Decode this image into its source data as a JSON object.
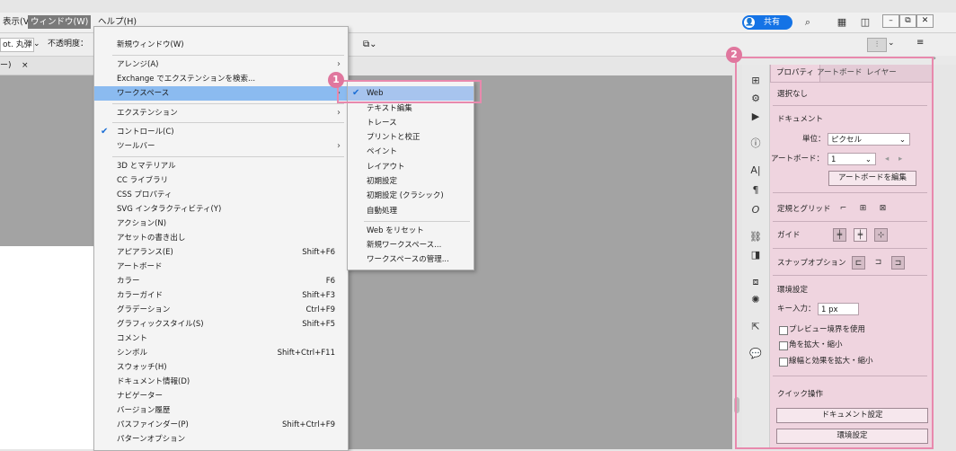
{
  "menubar": {
    "items": [
      {
        "label": "表示(V)"
      },
      {
        "label": "ウィンドウ(W)"
      },
      {
        "label": "ヘルプ(H)"
      }
    ],
    "share_label": "共有",
    "window_min": "–",
    "window_restore": "⧉",
    "window_close": "✕"
  },
  "controlbar": {
    "font": "ot. 丸弾",
    "opacity_label": "不透明度："
  },
  "tabs": {
    "close": "×",
    "partial": "ー)"
  },
  "window_menu": {
    "items": [
      {
        "label": "新規ウィンドウ(W)",
        "shortcut": "",
        "submenu": false,
        "checked": false
      },
      {
        "label": "アレンジ(A)",
        "shortcut": "",
        "submenu": true,
        "checked": false
      },
      {
        "label": "Exchange でエクステンションを検索...",
        "shortcut": "",
        "submenu": false,
        "checked": false
      },
      {
        "label": "ワークスペース",
        "shortcut": "",
        "submenu": true,
        "checked": false,
        "highlighted": true
      },
      {
        "label": "エクステンション",
        "shortcut": "",
        "submenu": true,
        "checked": false
      },
      {
        "label": "コントロール(C)",
        "shortcut": "",
        "submenu": false,
        "checked": true
      },
      {
        "label": "ツールバー",
        "shortcut": "",
        "submenu": true,
        "checked": false
      },
      {
        "label": "3D とマテリアル",
        "shortcut": "",
        "submenu": false,
        "checked": false
      },
      {
        "label": "CC ライブラリ",
        "shortcut": "",
        "submenu": false,
        "checked": false
      },
      {
        "label": "CSS プロパティ",
        "shortcut": "",
        "submenu": false,
        "checked": false
      },
      {
        "label": "SVG インタラクティビティ(Y)",
        "shortcut": "",
        "submenu": false,
        "checked": false
      },
      {
        "label": "アクション(N)",
        "shortcut": "",
        "submenu": false,
        "checked": false
      },
      {
        "label": "アセットの書き出し",
        "shortcut": "",
        "submenu": false,
        "checked": false
      },
      {
        "label": "アピアランス(E)",
        "shortcut": "Shift+F6",
        "submenu": false,
        "checked": false
      },
      {
        "label": "アートボード",
        "shortcut": "",
        "submenu": false,
        "checked": false
      },
      {
        "label": "カラー",
        "shortcut": "F6",
        "submenu": false,
        "checked": false
      },
      {
        "label": "カラーガイド",
        "shortcut": "Shift+F3",
        "submenu": false,
        "checked": false
      },
      {
        "label": "グラデーション",
        "shortcut": "Ctrl+F9",
        "submenu": false,
        "checked": false
      },
      {
        "label": "グラフィックスタイル(S)",
        "shortcut": "Shift+F5",
        "submenu": false,
        "checked": false
      },
      {
        "label": "コメント",
        "shortcut": "",
        "submenu": false,
        "checked": false
      },
      {
        "label": "シンボル",
        "shortcut": "Shift+Ctrl+F11",
        "submenu": false,
        "checked": false
      },
      {
        "label": "スウォッチ(H)",
        "shortcut": "",
        "submenu": false,
        "checked": false
      },
      {
        "label": "ドキュメント情報(D)",
        "shortcut": "",
        "submenu": false,
        "checked": false
      },
      {
        "label": "ナビゲーター",
        "shortcut": "",
        "submenu": false,
        "checked": false
      },
      {
        "label": "バージョン履歴",
        "shortcut": "",
        "submenu": false,
        "checked": false
      },
      {
        "label": "パスファインダー(P)",
        "shortcut": "Shift+Ctrl+F9",
        "submenu": false,
        "checked": false
      },
      {
        "label": "パターンオプション",
        "shortcut": "",
        "submenu": false,
        "checked": false
      }
    ]
  },
  "workspace_menu": {
    "items": [
      {
        "label": "Web",
        "checked": true,
        "highlighted": true
      },
      {
        "label": "テキスト編集",
        "checked": false
      },
      {
        "label": "トレース",
        "checked": false
      },
      {
        "label": "プリントと校正",
        "checked": false
      },
      {
        "label": "ペイント",
        "checked": false
      },
      {
        "label": "レイアウト",
        "checked": false
      },
      {
        "label": "初期設定",
        "checked": false
      },
      {
        "label": "初期設定 (クラシック)",
        "checked": false
      },
      {
        "label": "自動処理",
        "checked": false
      },
      {
        "label": "Web をリセット",
        "checked": false
      },
      {
        "label": "新規ワークスペース...",
        "checked": false
      },
      {
        "label": "ワークスペースの管理...",
        "checked": false
      }
    ]
  },
  "badges": {
    "one": "1",
    "two": "2"
  },
  "properties_panel": {
    "tabs": [
      "プロパティ",
      "アートボード",
      "レイヤー"
    ],
    "selection": "選択なし",
    "document_heading": "ドキュメント",
    "unit_label": "単位：",
    "unit_value": "ピクセル",
    "artboard_label": "アートボード：",
    "artboard_value": "1",
    "edit_artboard_button": "アートボードを編集",
    "rulers_grid_label": "定規とグリッド",
    "guides_label": "ガイド",
    "snap_label": "スナップオプション",
    "preferences_heading": "環境設定",
    "key_increment_label": "キー入力：",
    "key_increment_value": "1 px",
    "checkbox_preview_bounds": "プレビュー境界を使用",
    "checkbox_scale_corners": "角を拡大・縮小",
    "checkbox_scale_strokes": "線幅と効果を拡大・縮小",
    "quick_actions_heading": "クイック操作",
    "document_setup_button": "ドキュメント設定",
    "preferences_button": "環境設定"
  },
  "colors": {
    "highlight_pink": "#e889ad",
    "menu_highlight_blue": "#8bbbf0",
    "share_blue": "#1473e6"
  }
}
